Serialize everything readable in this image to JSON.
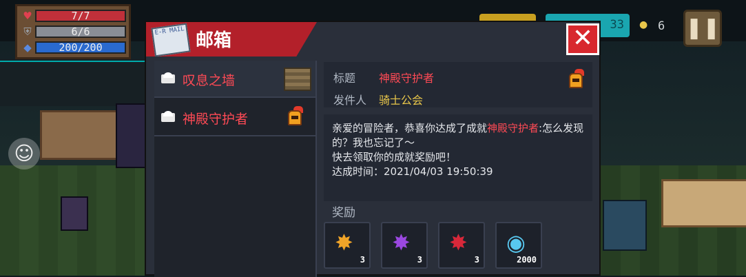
{
  "hud": {
    "hp": {
      "text": "7/7",
      "fraction": 1.0,
      "color": "#c0303a"
    },
    "armor": {
      "text": "6/6",
      "fraction": 1.0,
      "color": "#8a8e96"
    },
    "energy": {
      "text": "200/200",
      "fraction": 1.0,
      "color": "#2a6acf"
    },
    "coin_count": "6",
    "partial_counter": "33"
  },
  "mailbox": {
    "title": "邮箱",
    "mail_icon_text": "E-R MAIL",
    "items": [
      {
        "label": "叹息之墙"
      },
      {
        "label": "神殿守护者"
      }
    ],
    "detail": {
      "subject_label": "标题",
      "subject_value": "神殿守护者",
      "sender_label": "发件人",
      "sender_value": "骑士公会"
    },
    "body": {
      "line1_pre": "亲爱的冒险者，恭喜你达成了成就",
      "line1_hl": "神殿守护者",
      "line1_post": ":怎么发现的？我也忘记了～",
      "line2": "快去领取你的成就奖励吧！",
      "line3": "达成时间：2021/04/03 19:50:39"
    },
    "reward_title": "奖励",
    "rewards": [
      {
        "count": "3",
        "color": "#f0a428"
      },
      {
        "count": "3",
        "color": "#9a48e0"
      },
      {
        "count": "3",
        "color": "#d8283a"
      },
      {
        "count": "2000",
        "color": "#58c8f0"
      }
    ]
  }
}
